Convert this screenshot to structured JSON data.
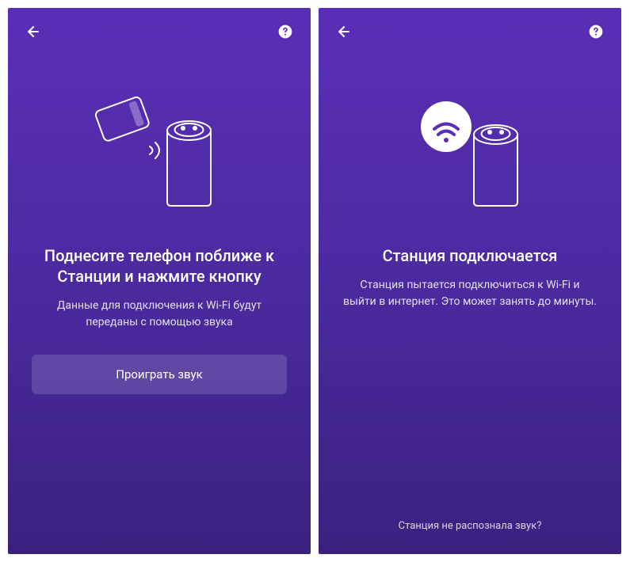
{
  "screen1": {
    "title": "Поднесите телефон поближе  к Станции и нажмите кнопку",
    "subtitle": "Данные для подключения к Wi-Fi будут переданы с помощью звука",
    "button_label": "Проиграть звук"
  },
  "screen2": {
    "title": "Станция подключается",
    "subtitle": "Станция пытается подключиться к Wi-Fi и выйти в интернет. Это может занять до минуты.",
    "bottom_link": "Станция не распознала звук?"
  }
}
